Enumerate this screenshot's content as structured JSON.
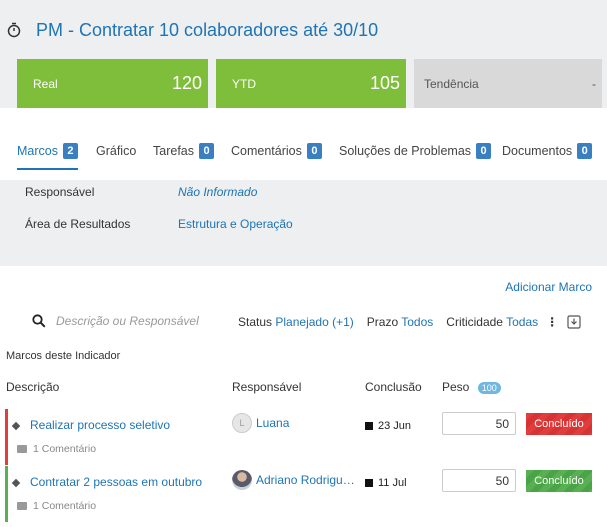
{
  "page": {
    "title": "PM - Contratar 10 colaboradores até 30/10"
  },
  "kpis": {
    "real": {
      "label": "Real",
      "value": "120"
    },
    "ytd": {
      "label": "YTD",
      "value": "105"
    },
    "trend": {
      "label": "Tendência",
      "value": "-"
    }
  },
  "tabs": [
    {
      "label": "Marcos",
      "count": "2"
    },
    {
      "label": "Gráfico"
    },
    {
      "label": "Tarefas",
      "count": "0"
    },
    {
      "label": "Comentários",
      "count": "0"
    },
    {
      "label": "Soluções de Problemas",
      "count": "0"
    },
    {
      "label": "Documentos",
      "count": "0"
    }
  ],
  "info": {
    "responsavel_label": "Responsável",
    "responsavel_value": "Não Informado",
    "area_label": "Área de Resultados",
    "area_value": "Estrutura e Operação"
  },
  "toolbar": {
    "add_milestone": "Adicionar Marco",
    "search_placeholder": "Descrição ou Responsável",
    "status_label": "Status",
    "status_value": "Planejado (+1)",
    "prazo_label": "Prazo",
    "prazo_value": "Todos",
    "criticidade_label": "Criticidade",
    "criticidade_value": "Todas"
  },
  "milestones": {
    "section_title": "Marcos deste Indicador",
    "columns": {
      "descricao": "Descrição",
      "responsavel": "Responsável",
      "conclusao": "Conclusão",
      "peso": "Peso",
      "peso_total": "100"
    },
    "rows": [
      {
        "description": "Realizar processo seletivo",
        "comments": "1 Comentário",
        "owner": "Luana",
        "owner_initial": "L",
        "date": "23 Jun",
        "weight": "50",
        "status": "Concluído",
        "bar_color": "#e23d3d",
        "status_color": "#e23d3d"
      },
      {
        "description": "Contratar 2 pessoas em outubro",
        "comments": "1 Comentário",
        "owner": "Adriano Rodrigu…",
        "date": "11 Jul",
        "weight": "50",
        "status": "Concluído",
        "bar_color": "#58b052",
        "status_color": "#58b052"
      }
    ]
  },
  "colors": {
    "accent": "#1e74b5",
    "kpi_green": "#7fbe3a",
    "badge_blue": "#3a7fc1"
  }
}
